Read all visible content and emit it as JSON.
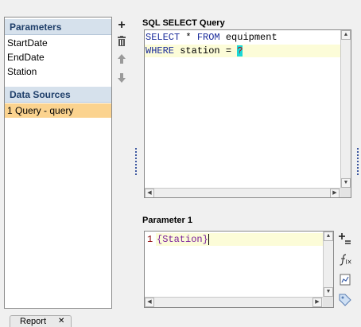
{
  "left": {
    "parameters_header": "Parameters",
    "parameters": [
      "StartDate",
      "EndDate",
      "Station"
    ],
    "datasources_header": "Data Sources",
    "datasources": [
      "1 Query - query"
    ]
  },
  "sql": {
    "label": "SQL SELECT Query",
    "line1": {
      "kw1": "SELECT",
      "star": " * ",
      "kw2": "FROM",
      "rest": " equipment"
    },
    "line2": {
      "kw": "WHERE",
      "rest": " station = ",
      "param": "?"
    }
  },
  "parameter": {
    "label": "Parameter 1",
    "line_number": "1",
    "value": "{Station}"
  },
  "bottom_tab": {
    "label": "Report",
    "close": "✕"
  }
}
